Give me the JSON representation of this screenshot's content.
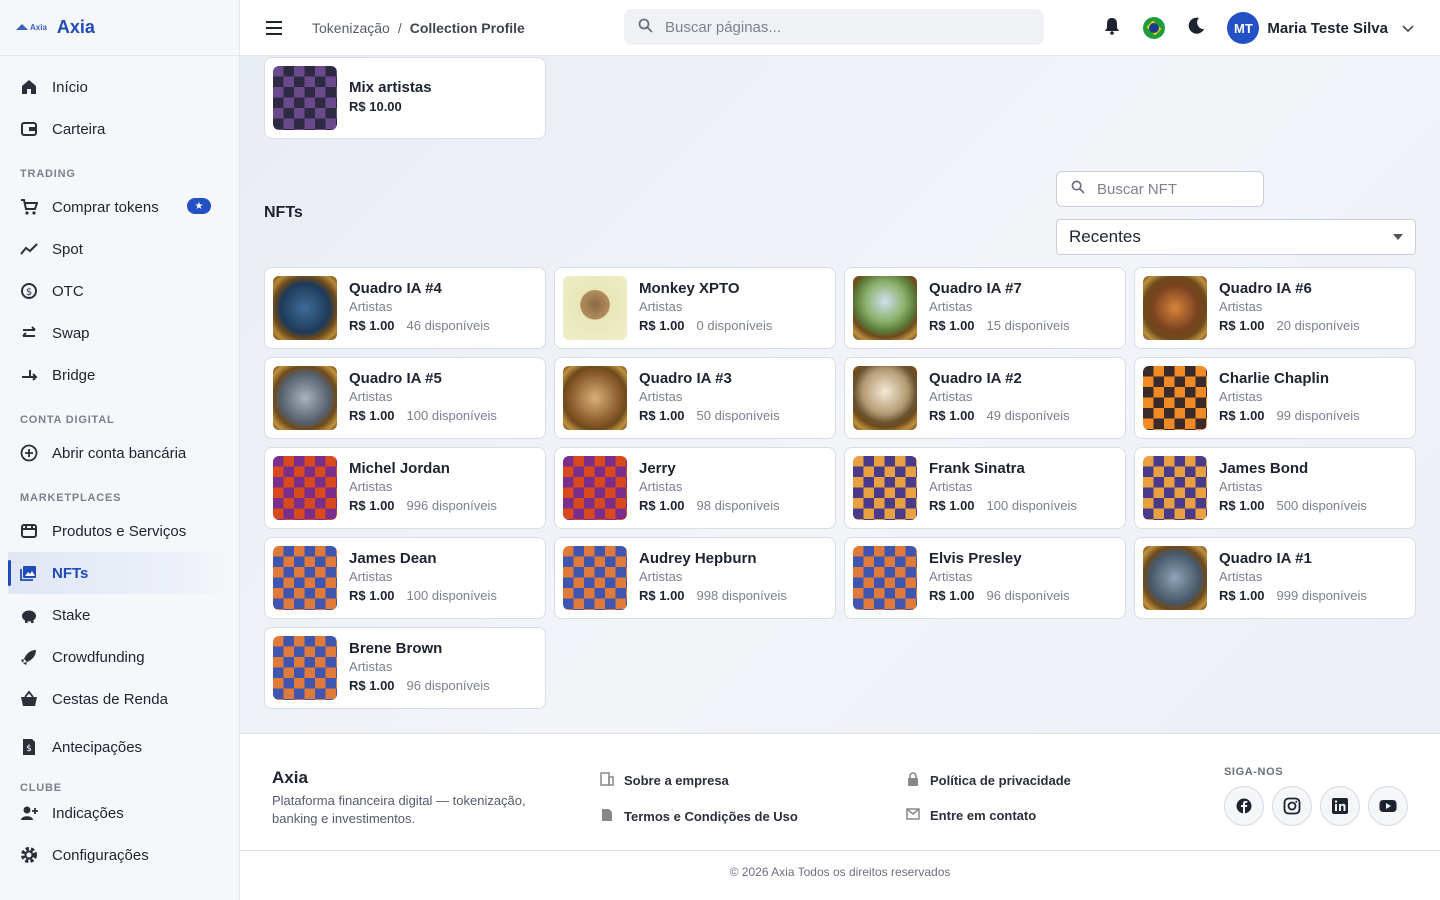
{
  "brand": {
    "mini": "Axia",
    "name": "Axia"
  },
  "nav": {
    "top": [
      {
        "label": "Início",
        "icon": "home-icon"
      },
      {
        "label": "Carteira",
        "icon": "wallet-icon"
      }
    ],
    "trading_title": "TRADING",
    "trading": [
      {
        "label": "Comprar tokens",
        "icon": "cart-icon"
      },
      {
        "label": "Spot",
        "icon": "chart-line-icon"
      },
      {
        "label": "OTC",
        "icon": "otc-icon"
      },
      {
        "label": "Swap",
        "icon": "swap-icon"
      },
      {
        "label": "Bridge",
        "icon": "bridge-icon"
      }
    ],
    "conta_title": "CONTA DIGITAL",
    "conta": [
      {
        "label": "Abrir conta bancária",
        "icon": "plus-circle-icon"
      }
    ],
    "market_title": "MARKETPLACES",
    "market": [
      {
        "label": "Produtos e Serviços",
        "icon": "store-icon"
      },
      {
        "label": "NFTs",
        "icon": "image-icon"
      },
      {
        "label": "Stake",
        "icon": "piggy-bank-icon"
      },
      {
        "label": "Crowdfunding",
        "icon": "rocket-icon"
      },
      {
        "label": "Cestas de Renda",
        "icon": "basket-icon"
      }
    ],
    "extra": [
      {
        "label": "Antecipações",
        "icon": "receipt-icon"
      }
    ],
    "clube_title": "CLUBE",
    "clube": [
      {
        "label": "Indicações",
        "icon": "person-add-icon"
      },
      {
        "label": "Configurações",
        "icon": "gear-icon"
      }
    ]
  },
  "topbar": {
    "crumb1": "Tokenização",
    "sep": "/",
    "crumb2": "Collection Profile",
    "search_placeholder": "Buscar páginas...",
    "user_initials": "MT",
    "user_name": "Maria Teste Silva"
  },
  "collection_card": {
    "title": "Mix artistas",
    "price": "R$ 10.00"
  },
  "nfts": {
    "title": "NFTs",
    "search_placeholder": "Buscar NFT",
    "sort_value": "Recentes",
    "items": [
      {
        "title": "Quadro IA #4",
        "category": "Artistas",
        "price": "R$ 1.00",
        "available": "46 disponíveis",
        "thumb": "painting-blue"
      },
      {
        "title": "Monkey XPTO",
        "category": "Artistas",
        "price": "R$ 1.00",
        "available": "0 disponíveis",
        "thumb": "monkey"
      },
      {
        "title": "Quadro IA #7",
        "category": "Artistas",
        "price": "R$ 1.00",
        "available": "15 disponíveis",
        "thumb": "painting-green"
      },
      {
        "title": "Quadro IA #6",
        "category": "Artistas",
        "price": "R$ 1.00",
        "available": "20 disponíveis",
        "thumb": "painting-amber"
      },
      {
        "title": "Quadro IA #5",
        "category": "Artistas",
        "price": "R$ 1.00",
        "available": "100 disponíveis",
        "thumb": "painting-grey"
      },
      {
        "title": "Quadro IA #3",
        "category": "Artistas",
        "price": "R$ 1.00",
        "available": "50 disponíveis",
        "thumb": "painting-brown"
      },
      {
        "title": "Quadro IA #2",
        "category": "Artistas",
        "price": "R$ 1.00",
        "available": "49 disponíveis",
        "thumb": "painting-light"
      },
      {
        "title": "Charlie Chaplin",
        "category": "Artistas",
        "price": "R$ 1.00",
        "available": "99 disponíveis",
        "thumb": "pop-orange"
      },
      {
        "title": "Michel Jordan",
        "category": "Artistas",
        "price": "R$ 1.00",
        "available": "996 disponíveis",
        "thumb": "pop-red"
      },
      {
        "title": "Jerry",
        "category": "Artistas",
        "price": "R$ 1.00",
        "available": "98 disponíveis",
        "thumb": "pop-red"
      },
      {
        "title": "Frank Sinatra",
        "category": "Artistas",
        "price": "R$ 1.00",
        "available": "100 disponíveis",
        "thumb": "pop-purple"
      },
      {
        "title": "James Bond",
        "category": "Artistas",
        "price": "R$ 1.00",
        "available": "500 disponíveis",
        "thumb": "pop-purple"
      },
      {
        "title": "James Dean",
        "category": "Artistas",
        "price": "R$ 1.00",
        "available": "100 disponíveis",
        "thumb": "pop-mixed"
      },
      {
        "title": "Audrey Hepburn",
        "category": "Artistas",
        "price": "R$ 1.00",
        "available": "998 disponíveis",
        "thumb": "pop-mixed"
      },
      {
        "title": "Elvis Presley",
        "category": "Artistas",
        "price": "R$ 1.00",
        "available": "96 disponíveis",
        "thumb": "pop-mixed"
      },
      {
        "title": "Quadro IA #1",
        "category": "Artistas",
        "price": "R$ 1.00",
        "available": "999 disponíveis",
        "thumb": "painting-steel"
      },
      {
        "title": "Brene Brown",
        "category": "Artistas",
        "price": "R$ 1.00",
        "available": "96 disponíveis",
        "thumb": "pop-mixed"
      }
    ]
  },
  "footer": {
    "brand": "Axia",
    "description": "Plataforma financeira digital — tokenização, banking e investimentos.",
    "links": [
      {
        "label": "Sobre a empresa",
        "icon": "building-icon"
      },
      {
        "label": "Termos e Condições de Uso",
        "icon": "document-icon"
      },
      {
        "label": "Política de privacidade",
        "icon": "lock-icon"
      },
      {
        "label": "Entre em contato",
        "icon": "mail-icon"
      }
    ],
    "follow_title": "SIGA-NOS",
    "social": [
      "facebook-icon",
      "instagram-icon",
      "linkedin-icon",
      "youtube-icon"
    ],
    "copyright": "© 2026 Axia Todos os direitos reservados"
  },
  "colors": {
    "accent": "#1e4bb8",
    "badge": "#2350c4"
  }
}
